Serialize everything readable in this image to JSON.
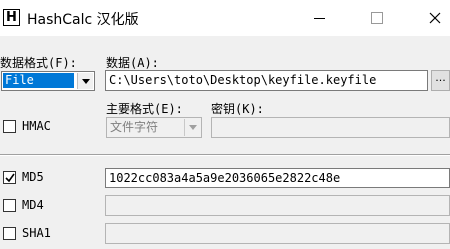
{
  "window": {
    "icon_letter": "H",
    "title": "HashCalc 汉化版"
  },
  "data_format": {
    "label": "数据格式(F):",
    "selected": "File"
  },
  "data": {
    "label": "数据(A):",
    "value": "C:\\Users\\toto\\Desktop\\keyfile.keyfile",
    "browse_label": "..."
  },
  "hmac": {
    "label": "HMAC",
    "checked": false
  },
  "key_format": {
    "label": "主要格式(E):",
    "selected": "文件字符"
  },
  "key": {
    "label": "密钥(K):",
    "value": ""
  },
  "hashes": [
    {
      "name": "MD5",
      "checked": true,
      "value": "1022cc083a4a5a9e2036065e2822c48e"
    },
    {
      "name": "MD4",
      "checked": false,
      "value": ""
    },
    {
      "name": "SHA1",
      "checked": false,
      "value": ""
    }
  ]
}
